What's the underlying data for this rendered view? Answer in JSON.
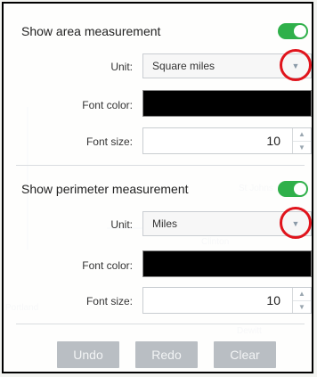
{
  "area": {
    "toggle_label": "Show area measurement",
    "toggle_on": true,
    "unit_label": "Unit:",
    "unit_value": "Square miles",
    "font_color_label": "Font color:",
    "font_color": "#000000",
    "font_size_label": "Font size:",
    "font_size": "10"
  },
  "perimeter": {
    "toggle_label": "Show perimeter measurement",
    "toggle_on": true,
    "unit_label": "Unit:",
    "unit_value": "Miles",
    "font_color_label": "Font color:",
    "font_color": "#000000",
    "font_size_label": "Font size:",
    "font_size": "10"
  },
  "actions": {
    "undo": "Undo",
    "redo": "Redo",
    "clear": "Clear"
  },
  "colors": {
    "toggle_on": "#2fb04a",
    "highlight_ring": "#e0141c",
    "disabled_button": "#b9bec3"
  },
  "icons": {
    "dropdown": "chevron-down-icon",
    "spin_up": "chevron-up-icon",
    "spin_down": "chevron-down-icon"
  }
}
